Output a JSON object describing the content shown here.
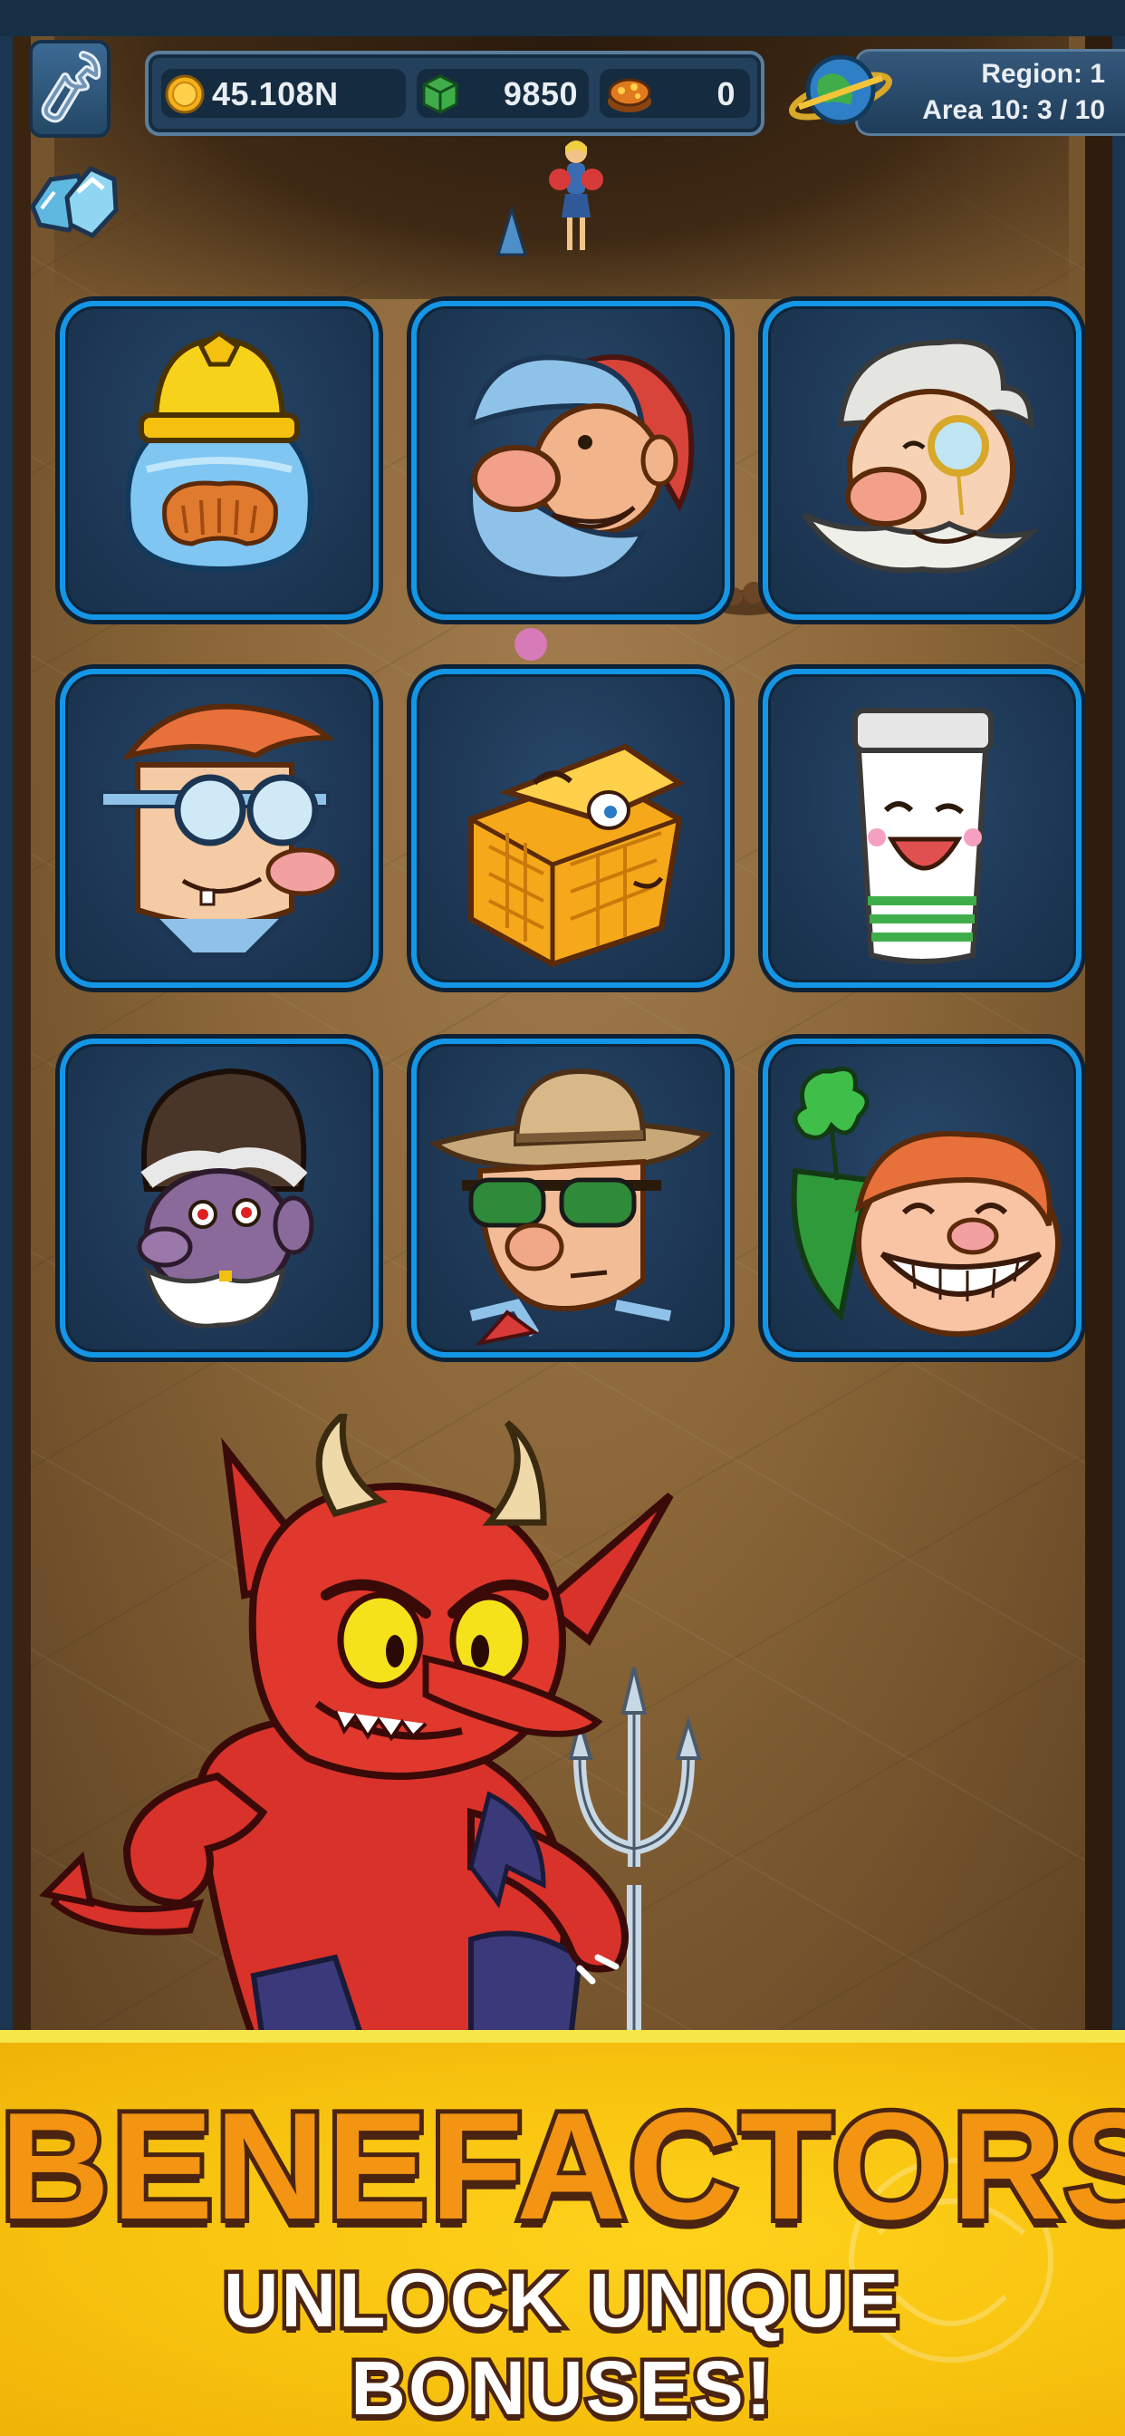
{
  "hud": {
    "coins": {
      "icon": "gold-coin-icon",
      "value": "45.108N"
    },
    "blocks": {
      "icon": "green-block-icon",
      "value": "9850"
    },
    "nuggets": {
      "icon": "treasure-chest-icon",
      "value": "0"
    },
    "settings_icon": "wrench-icon",
    "gems_icon": "gems-icon",
    "region": {
      "line1": "Region: 1",
      "line2": "Area 10: 3 / 10"
    }
  },
  "benefactors": [
    {
      "id": "slime-miner",
      "icon": "slime-miner-portrait-icon"
    },
    {
      "id": "gnome",
      "icon": "gnome-portrait-icon"
    },
    {
      "id": "monocle-gentleman",
      "icon": "monocle-gentleman-portrait-icon"
    },
    {
      "id": "goggles-nerd",
      "icon": "goggles-nerd-portrait-icon"
    },
    {
      "id": "gold-cube",
      "icon": "gold-cube-portrait-icon"
    },
    {
      "id": "coffee-cup",
      "icon": "coffee-cup-portrait-icon"
    },
    {
      "id": "evil-prospector",
      "icon": "evil-prospector-portrait-icon"
    },
    {
      "id": "cowboy",
      "icon": "cowboy-portrait-icon"
    },
    {
      "id": "leprechaun",
      "icon": "leprechaun-portrait-icon"
    }
  ],
  "banner": {
    "title": "BENEFACTORS!",
    "subtitle": "UNLOCK UNIQUE BONUSES!"
  },
  "colors": {
    "card_border": "#1496e6",
    "card_bg": "#1c3552",
    "banner_bg": "#f7c20e",
    "title_fill": "#f39413",
    "outline": "#4a2410"
  }
}
